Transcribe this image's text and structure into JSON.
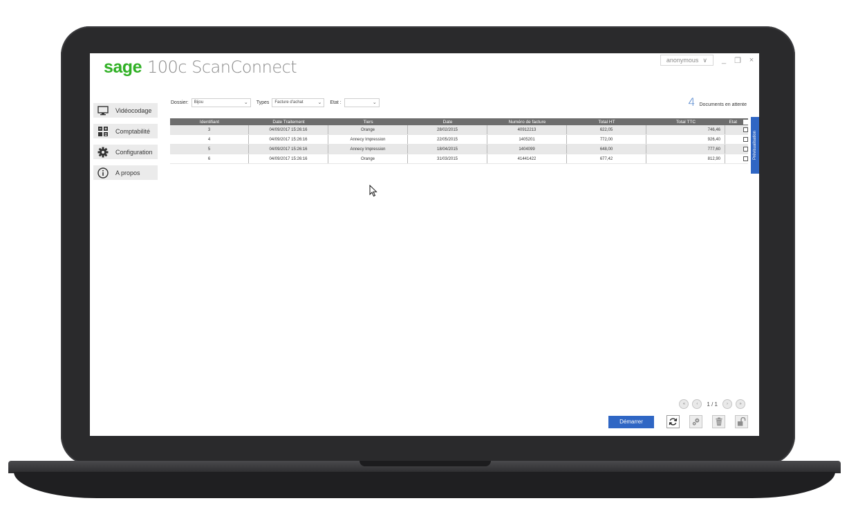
{
  "app": {
    "logo_brand": "sage",
    "logo_product": "100c ScanConnect"
  },
  "window": {
    "user": "anonymous",
    "minimize": "_",
    "restore": "❐",
    "close": "×"
  },
  "sidebar": {
    "items": [
      {
        "label": "Vidéocodage",
        "icon": "monitor-icon"
      },
      {
        "label": "Comptabilité",
        "icon": "calculator-icon"
      },
      {
        "label": "Configuration",
        "icon": "gear-icon"
      },
      {
        "label": "A propos",
        "icon": "info-icon"
      }
    ]
  },
  "filters": {
    "dossier_label": "Dossier:",
    "dossier_value": "Bijou",
    "types_label": "Types",
    "types_value": "Facture d'achat",
    "etat_label": "Etat :",
    "etat_value": ""
  },
  "pending": {
    "count": "4",
    "label": "Documents en attente"
  },
  "table": {
    "columns": [
      "Identifiant",
      "Date Traitement",
      "Tiers",
      "Date",
      "Numéro de facture",
      "Total HT",
      "Total TTC",
      "Etat"
    ],
    "rows": [
      {
        "id": "3",
        "date_traitement": "04/09/2017 15:26:16",
        "tiers": "Orange",
        "date": "28/02/2015",
        "numero": "40912213",
        "total_ht": "622,05",
        "total_ttc": "746,46"
      },
      {
        "id": "4",
        "date_traitement": "04/09/2017 15:26:16",
        "tiers": "Annecy Impression",
        "date": "22/05/2015",
        "numero": "1405201",
        "total_ht": "772,00",
        "total_ttc": "926,40"
      },
      {
        "id": "5",
        "date_traitement": "04/09/2017 15:26:16",
        "tiers": "Annecy Impression",
        "date": "18/04/2015",
        "numero": "1404099",
        "total_ht": "648,00",
        "total_ttc": "777,60"
      },
      {
        "id": "6",
        "date_traitement": "04/09/2017 15:26:16",
        "tiers": "Orange",
        "date": "31/03/2015",
        "numero": "41441422",
        "total_ht": "677,42",
        "total_ttc": "812,90"
      }
    ]
  },
  "preview_tab": "Prévisualisation",
  "pager": {
    "text": "1 / 1",
    "first": "«",
    "prev": "‹",
    "next": "›",
    "last": "»"
  },
  "actions": {
    "start_label": "Démarrer"
  },
  "colors": {
    "brand_green": "#2fb024",
    "accent_blue": "#2f66c4",
    "header_gray": "#6d6d6d"
  }
}
